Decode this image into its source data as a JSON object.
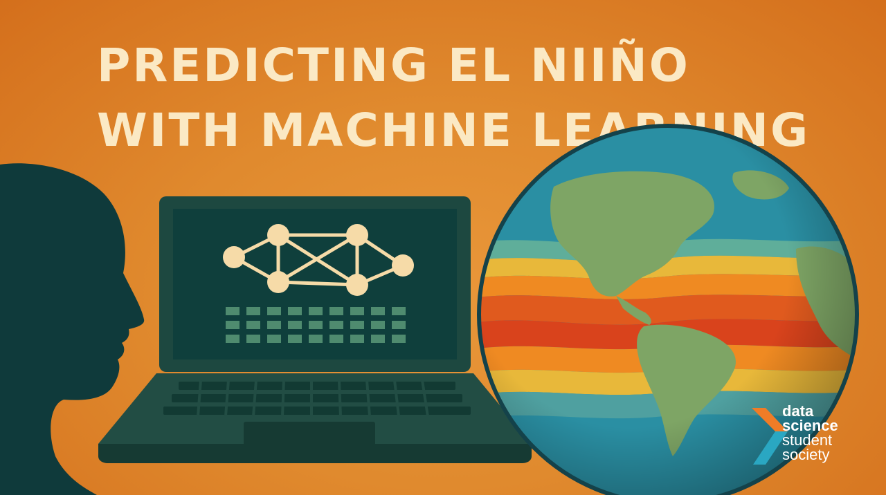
{
  "title": {
    "line1": "PREDICTING EL NIIÑO",
    "line2": "WITH MACHINE LEARNING"
  },
  "logo": {
    "line1": "data",
    "line2": "science",
    "line3": "student",
    "line4": "society"
  },
  "colors": {
    "background": "#e08a2e",
    "title": "#fbe9c4",
    "silhouette": "#0f3a3b",
    "laptop": "#1d4840",
    "screen": "#0f3f3c",
    "node": "#f6dba8",
    "ocean": "#2a8fa3",
    "land": "#7ea565",
    "warm": "#d9431c"
  },
  "icons": [
    "person-silhouette-icon",
    "laptop-icon",
    "neural-network-icon",
    "globe-icon",
    "logo-chevron-icon"
  ]
}
